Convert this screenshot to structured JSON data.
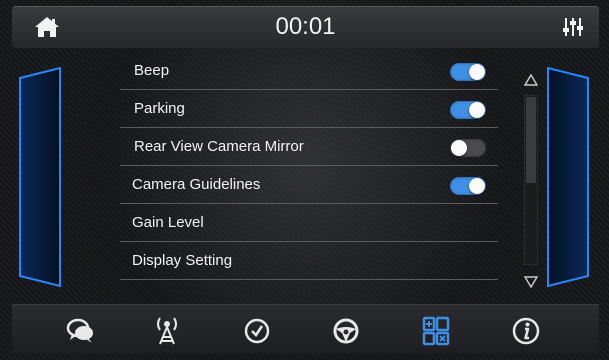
{
  "header": {
    "time": "00:01",
    "home_icon": "home-icon",
    "eq_icon": "equalizer-icon"
  },
  "settings": [
    {
      "label": "Beep",
      "toggle": "on"
    },
    {
      "label": "Parking",
      "toggle": "on"
    },
    {
      "label": "Rear View Camera Mirror",
      "toggle": "off"
    },
    {
      "label": "Camera Guidelines",
      "toggle": "on"
    },
    {
      "label": "Gain Level",
      "toggle": null
    },
    {
      "label": "Display Setting",
      "toggle": null
    }
  ],
  "bottom_nav": [
    {
      "icon": "chat-icon"
    },
    {
      "icon": "radio-antenna-icon"
    },
    {
      "icon": "clock-icon"
    },
    {
      "icon": "steering-wheel-icon"
    },
    {
      "icon": "apps-icon",
      "active": true
    },
    {
      "icon": "info-icon"
    }
  ],
  "colors": {
    "accent_blue": "#3f8fe6",
    "toggle_off": "#4b4b4d",
    "side_glow": "#1e73d9"
  }
}
